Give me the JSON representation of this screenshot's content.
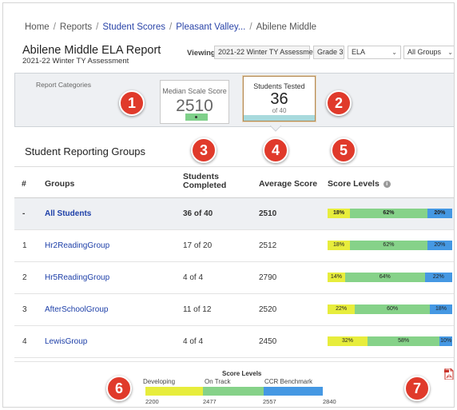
{
  "breadcrumb": {
    "items": [
      {
        "label": "Home",
        "link": false
      },
      {
        "label": "Reports",
        "link": false
      },
      {
        "label": "Student Scores",
        "link": true
      },
      {
        "label": "Pleasant Valley...",
        "link": true
      },
      {
        "label": "Abilene Middle",
        "link": false
      }
    ],
    "separator": "/"
  },
  "header": {
    "title": "Abilene Middle ELA Report",
    "subtitle": "2021-22 Winter TY Assessment",
    "viewing_label": "Viewing:",
    "assessment": "2021-22 Winter TY Assessment",
    "grade": "Grade 3",
    "subject_select": "ELA",
    "group_select": "All Groups"
  },
  "categories": {
    "label": "Report Categories",
    "median_card": {
      "label": "Median Scale Score",
      "value": "2510"
    },
    "tested_card": {
      "label": "Students Tested",
      "value": "36",
      "sub": "of 40"
    }
  },
  "groups_section": {
    "title": "Student Reporting Groups",
    "columns": [
      "#",
      "Groups",
      "Students\nCompleted",
      "Average Score",
      "Score Levels"
    ],
    "rows": [
      {
        "num": "-",
        "group": "All Students",
        "completed": "36 of 40",
        "avg": "2510",
        "levels": [
          "18%",
          "62%",
          "20%"
        ],
        "pct": [
          18,
          62,
          20
        ]
      },
      {
        "num": "1",
        "group": "Hr2ReadingGroup",
        "completed": "17 of 20",
        "avg": "2512",
        "levels": [
          "18%",
          "62%",
          "20%"
        ],
        "pct": [
          18,
          62,
          20
        ]
      },
      {
        "num": "2",
        "group": "Hr5ReadingGroup",
        "completed": "4 of 4",
        "avg": "2790",
        "levels": [
          "14%",
          "64%",
          "22%"
        ],
        "pct": [
          14,
          64,
          22
        ]
      },
      {
        "num": "3",
        "group": "AfterSchoolGroup",
        "completed": "11 of 12",
        "avg": "2520",
        "levels": [
          "22%",
          "60%",
          "18%"
        ],
        "pct": [
          22,
          60,
          18
        ]
      },
      {
        "num": "4",
        "group": "LewisGroup",
        "completed": "4 of 4",
        "avg": "2450",
        "levels": [
          "32%",
          "58%",
          "10%"
        ],
        "pct": [
          32,
          58,
          10
        ]
      }
    ]
  },
  "legend": {
    "title": "Score Levels",
    "levels": [
      "Developing",
      "On Track",
      "CCR Benchmark"
    ],
    "cutoffs": [
      "2200",
      "2477",
      "2557",
      "2840"
    ]
  },
  "callouts": [
    "1",
    "2",
    "3",
    "4",
    "5",
    "6",
    "7"
  ],
  "colors": {
    "developing": "#e7ed3c",
    "on_track": "#86d289",
    "ccr": "#4598e3",
    "callout": "#e03a2b",
    "link": "#1d3fa8"
  },
  "icons": [
    "info-icon",
    "pdf-icon",
    "chevron-down-icon"
  ]
}
